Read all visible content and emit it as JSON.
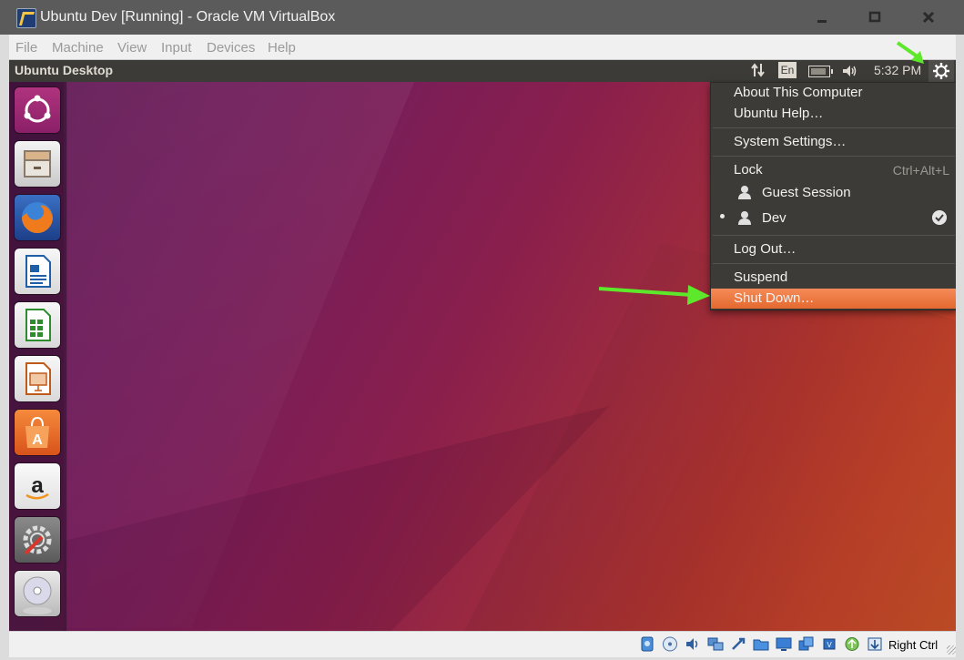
{
  "window": {
    "title": "Ubuntu Dev [Running] - Oracle VM VirtualBox",
    "minimize_glyph": "_",
    "maximize_glyph": "□",
    "close_glyph": "X"
  },
  "menubar": {
    "items": [
      "File",
      "Machine",
      "View",
      "Input",
      "Devices",
      "Help"
    ]
  },
  "guest": {
    "panel_title": "Ubuntu Desktop",
    "language_indicator": "En",
    "clock": "5:32 PM",
    "launcher_icons": [
      "ubuntu-dash-icon",
      "files-icon",
      "firefox-icon",
      "writer-icon",
      "calc-icon",
      "impress-icon",
      "software-center-icon",
      "amazon-icon",
      "system-settings-icon",
      "dvd-icon"
    ],
    "system_menu": {
      "about": "About This Computer",
      "help": "Ubuntu Help…",
      "settings": "System Settings…",
      "lock": "Lock",
      "lock_shortcut": "Ctrl+Alt+L",
      "guest_session": "Guest Session",
      "current_user": "Dev",
      "log_out": "Log Out…",
      "suspend": "Suspend",
      "shut_down": "Shut Down…"
    }
  },
  "statusbar": {
    "host_key": "Right Ctrl",
    "icons": [
      "hard-disk-icon",
      "optical-drive-icon",
      "audio-icon",
      "network-icon",
      "usb-icon",
      "shared-folders-icon",
      "display-icon",
      "video-capture-icon",
      "cpu-virtualization-icon",
      "mouse-integration-icon",
      "keyboard-capture-icon"
    ]
  },
  "colors": {
    "highlight": "#f07746",
    "annotation_arrow": "#5ee82c",
    "ubuntu_panel": "#3c3b37"
  }
}
